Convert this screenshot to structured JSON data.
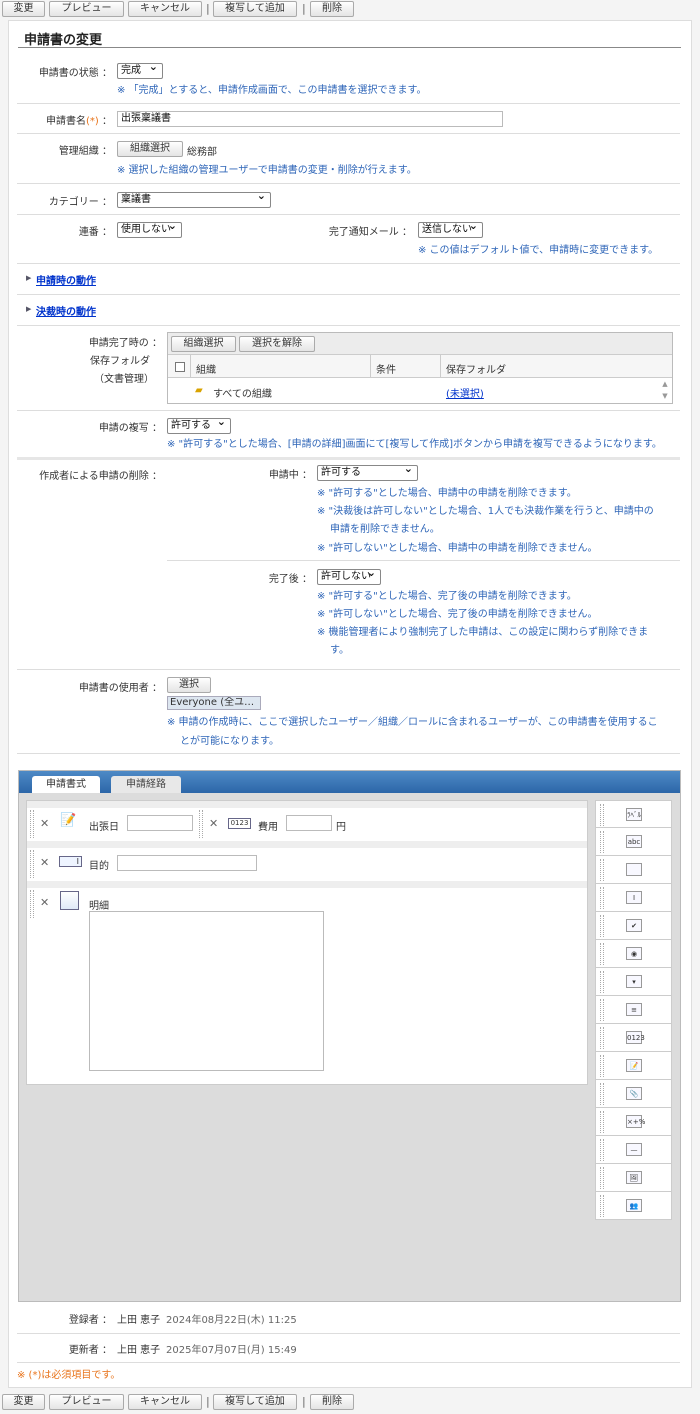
{
  "toolbar": {
    "change": "変更",
    "preview": "プレビュー",
    "cancel": "キャンセル",
    "copy_add": "複写して追加",
    "delete": "削除",
    "separator": "|"
  },
  "page_title": "申請書の変更",
  "status": {
    "label": "申請書の状態 ：",
    "value": "完成",
    "note": "※ 「完成」とすると、申請作成画面で、この申請書を選択できます。"
  },
  "name": {
    "label": "申請書名",
    "required_mark": "(*)",
    "colon": "：",
    "value": "出張稟議書"
  },
  "org": {
    "label": "管理組織 ：",
    "button": "組織選択",
    "value": "総務部",
    "note": "※ 選択した組織の管理ユーザーで申請書の変更・削除が行えます。"
  },
  "category": {
    "label": "カテゴリー ：",
    "value": "稟議書"
  },
  "serial": {
    "label": "連番 ：",
    "value": "使用しない"
  },
  "mail": {
    "label": "完了通知メール ：",
    "value": "送信しない",
    "note": "※ この値はデフォルト値で、申請時に変更できます。"
  },
  "sections": {
    "on_apply": "申請時の動作",
    "on_decide": "決裁時の動作"
  },
  "folder": {
    "label1": "申請完了時の ：",
    "label2": "保存フォルダ",
    "label3": "（文書管理）",
    "btn_select": "組織選択",
    "btn_clear": "選択を解除",
    "columns": [
      "組織",
      "条件",
      "保存フォルダ"
    ],
    "rows": [
      {
        "org": "すべての組織",
        "condition": "",
        "folder": "(未選択)"
      }
    ]
  },
  "copy": {
    "label": "申請の複写 ：",
    "value": "許可する",
    "note": "※ \"許可する\"とした場合、[申請の詳細]画面にて[複写して作成]ボタンから申請を複写できるようになります。"
  },
  "deletion": {
    "label": "作成者による申請の削除 ：",
    "pending": {
      "label": "申請中 ：",
      "value": "許可する",
      "notes": [
        "※ \"許可する\"とした場合、申請中の申請を削除できます。",
        "※ \"決裁後は許可しない\"とした場合、1人でも決裁作業を行うと、申請中の",
        "申請を削除できません。",
        "※ \"許可しない\"とした場合、申請中の申請を削除できません。"
      ]
    },
    "done": {
      "label": "完了後 ：",
      "value": "許可しない",
      "notes": [
        "※ \"許可する\"とした場合、完了後の申請を削除できます。",
        "※ \"許可しない\"とした場合、完了後の申請を削除できません。",
        "※ 機能管理者により強制完了した申請は、この設定に関わらず削除できま",
        "す。"
      ]
    }
  },
  "users": {
    "label": "申請書の使用者 ：",
    "button": "選択",
    "chip": "Everyone (全ユ…",
    "notes": [
      "※ 申請の作成時に、ここで選択したユーザー／組織／ロールに含まれるユーザーが、この申請書を使用するこ",
      "とが可能になります。"
    ]
  },
  "designer": {
    "tabs": [
      {
        "label": "申請書式",
        "active": true
      },
      {
        "label": "申請経路",
        "active": false
      }
    ],
    "fields": [
      {
        "label": "出張日",
        "icon": "calendar-icon"
      },
      {
        "label": "費用",
        "icon": "number-icon",
        "unit": "円"
      },
      {
        "label": "目的",
        "icon": "text-input-icon"
      },
      {
        "label": "明細",
        "icon": "textarea-icon"
      }
    ],
    "palette": [
      {
        "icon": "label-icon",
        "glyph": "ﾗﾍﾞﾙ"
      },
      {
        "icon": "string-icon",
        "glyph": "abc"
      },
      {
        "icon": "textarea-icon",
        "glyph": ""
      },
      {
        "icon": "text-input-icon",
        "glyph": "I"
      },
      {
        "icon": "checkbox-icon",
        "glyph": "✔"
      },
      {
        "icon": "radio-icon",
        "glyph": "◉"
      },
      {
        "icon": "dropdown-icon",
        "glyph": "▾"
      },
      {
        "icon": "listbox-icon",
        "glyph": "≡"
      },
      {
        "icon": "number-icon",
        "glyph": "0123"
      },
      {
        "icon": "calendar-icon",
        "glyph": "📝"
      },
      {
        "icon": "attachment-icon",
        "glyph": "📎"
      },
      {
        "icon": "calculation-icon",
        "glyph": "×+%"
      },
      {
        "icon": "line-icon",
        "glyph": "—"
      },
      {
        "icon": "image-icon",
        "glyph": "🖼"
      },
      {
        "icon": "user-select-icon",
        "glyph": "👥"
      }
    ]
  },
  "registered": {
    "label": "登録者 ：",
    "user": "上田 恵子",
    "date": "2024年08月22日(木) 11:25"
  },
  "updated": {
    "label": "更新者 ：",
    "user": "上田 恵子",
    "date": "2025年07月07日(月) 15:49"
  },
  "required_note": "※ (*)は必須項目です。"
}
